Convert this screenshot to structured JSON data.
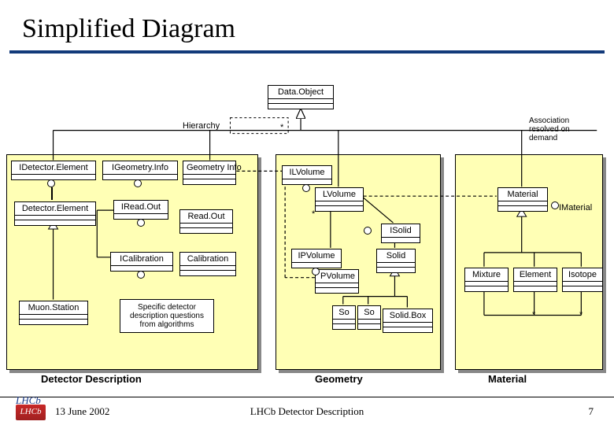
{
  "title": "Simplified Diagram",
  "labels": {
    "hierarchy": "Hierarchy",
    "assoc_note": "Association resolved on demand",
    "star": "*",
    "star2": "*",
    "star3": "*",
    "star4": "*"
  },
  "classes": {
    "dataobject": "Data.Object",
    "idetectorelement": "IDetector.Element",
    "igeometryinfo": "IGeometry.Info",
    "geometryinfo": "Geometry Info",
    "detectorelement": "Detector.Element",
    "ireadout": "IRead.Out",
    "readout": "Read.Out",
    "icalibration": "ICalibration",
    "calibration": "Calibration",
    "muonstation": "Muon.Station",
    "ilvolume": "ILVolume",
    "lvolume": "LVolume",
    "ipvolume": "IPVolume",
    "pvolume": "PVolume",
    "isolid": "ISolid",
    "solid": "Solid",
    "solidbox": "Solid.Box",
    "so1": "So",
    "so2": "So",
    "material": "Material",
    "imaterial": "IMaterial",
    "mixture": "Mixture",
    "element": "Element",
    "isotope": "Isotope"
  },
  "note": "Specific detector description questions from algorithms",
  "packages": {
    "detdesc": "Detector Description",
    "geometry": "Geometry",
    "material": "Material"
  },
  "footer": {
    "date": "13 June 2002",
    "center": "LHCb Detector Description",
    "page": "7",
    "logo": "LHCb"
  }
}
